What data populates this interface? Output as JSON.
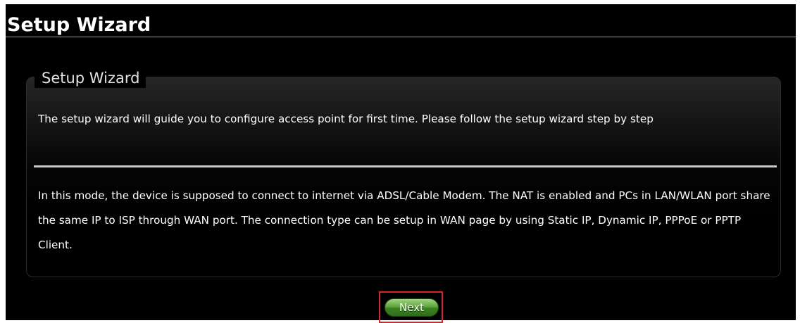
{
  "page": {
    "title": "Setup Wizard"
  },
  "wizard": {
    "legend": "Setup Wizard",
    "intro": "The setup wizard will guide you to configure access point for first time. Please follow the setup wizard step by step",
    "mode_description": "In this mode, the device is supposed to connect to internet via ADSL/Cable Modem. The NAT is enabled and PCs in LAN/WLAN port share the same IP to ISP through WAN port. The connection type can be setup in WAN page by using Static IP, Dynamic IP, PPPoE or PPTP Client."
  },
  "actions": {
    "next_label": "Next"
  },
  "colors": {
    "background": "#000000",
    "text": "#ffffff",
    "button_green": "#3b8122",
    "highlight_border": "#d8242a"
  }
}
